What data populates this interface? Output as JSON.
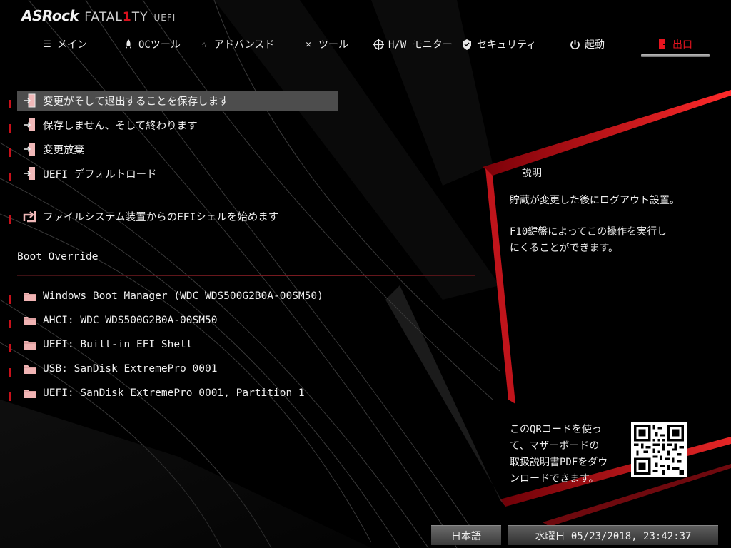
{
  "header": {
    "brand": "ASRock",
    "product_prefix": "FATAL",
    "product_highlight": "1",
    "product_suffix": "TY",
    "edition": "UEFI"
  },
  "tabs": [
    {
      "label": "メイン",
      "icon": "list-icon"
    },
    {
      "label": "OCツール",
      "icon": "rocket-icon"
    },
    {
      "label": "アドバンスド",
      "icon": "star-icon"
    },
    {
      "label": "ツール",
      "icon": "tools-icon"
    },
    {
      "label": "H/W モニター",
      "icon": "crosshair-icon"
    },
    {
      "label": "セキュリティ",
      "icon": "shield-icon"
    },
    {
      "label": "起動",
      "icon": "power-icon"
    },
    {
      "label": "出口",
      "icon": "exit-icon",
      "active": true
    }
  ],
  "menu": {
    "save_exit": "変更がそして退出することを保存します",
    "discard_exit": "保存しません、そして終わります",
    "discard_changes": "変更放棄",
    "load_defaults": "UEFI デフォルトロード",
    "efi_shell": "ファイルシステム装置からのEFIシェルを始めます"
  },
  "boot_override": {
    "label": "Boot Override",
    "items": [
      "Windows Boot Manager (WDC WDS500G2B0A-00SM50)",
      "AHCI:  WDC WDS500G2B0A-00SM50",
      "UEFI: Built-in EFI Shell",
      "USB: SanDisk ExtremePro 0001",
      "UEFI: SanDisk ExtremePro 0001, Partition 1"
    ]
  },
  "description": {
    "title": "説明",
    "line1": "貯蔵が変更した後にログアウト設置。",
    "line2a": "F10鍵盤によってこの操作を実行し",
    "line2b": "にくることができます。"
  },
  "qr": {
    "line1": "このQRコードを使っ",
    "line2": "て、マザーボードの",
    "line3": "取扱説明書PDFをダウ",
    "line4": "ンロードできます。"
  },
  "footer": {
    "language": "日本語",
    "datetime": "水曜日 05/23/2018, 23:42:37"
  },
  "colors": {
    "accent": "#e8141f",
    "highlight": "#4d4d4d",
    "background": "#000000"
  }
}
